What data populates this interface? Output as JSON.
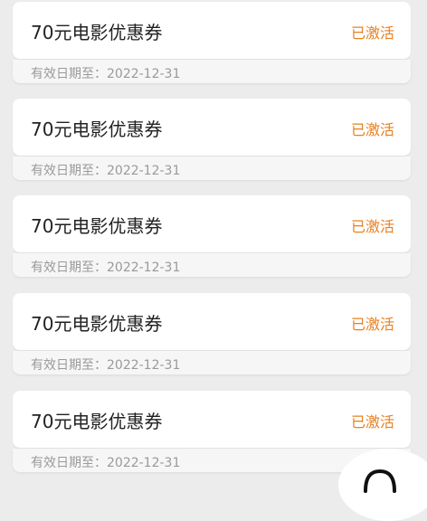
{
  "coupons": [
    {
      "title": "70元电影优惠券",
      "status": "已激活",
      "validity": "有效日期至：2022-12-31"
    },
    {
      "title": "70元电影优惠券",
      "status": "已激活",
      "validity": "有效日期至：2022-12-31"
    },
    {
      "title": "70元电影优惠券",
      "status": "已激活",
      "validity": "有效日期至：2022-12-31"
    },
    {
      "title": "70元电影优惠券",
      "status": "已激活",
      "validity": "有效日期至：2022-12-31"
    },
    {
      "title": "70元电影优惠券",
      "status": "已激活",
      "validity": "有效日期至：2022-12-31"
    }
  ],
  "colors": {
    "status": "#e8801f",
    "background": "#ececec",
    "card": "#ffffff"
  },
  "floating_button": {
    "icon": "chat-bubble-icon"
  }
}
